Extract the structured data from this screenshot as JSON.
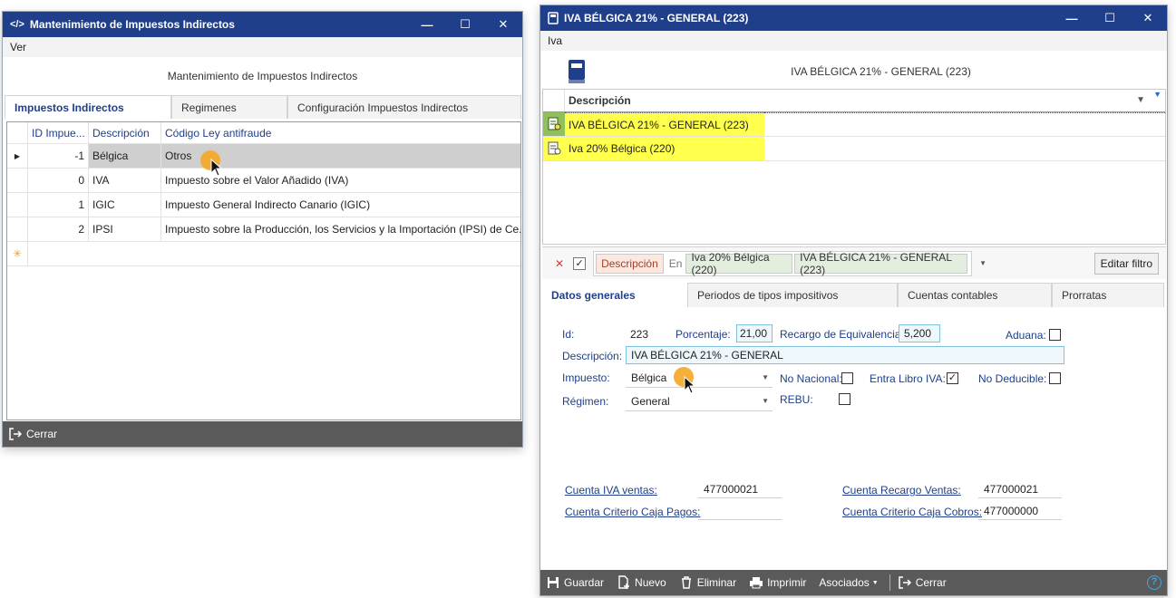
{
  "left_window": {
    "title": "Mantenimiento de Impuestos Indirectos",
    "title_icon": "</>",
    "menu": [
      "Ver"
    ],
    "header": "Mantenimiento de Impuestos Indirectos",
    "tabs": [
      "Impuestos Indirectos",
      "Regimenes",
      "Configuración Impuestos Indirectos"
    ],
    "grid": {
      "columns": [
        "ID Impue...",
        "Descripción",
        "Código Ley antifraude"
      ],
      "rows": [
        {
          "id": "-1",
          "desc": "Bélgica",
          "code": "Otros"
        },
        {
          "id": "0",
          "desc": "IVA",
          "code": "Impuesto sobre el Valor Añadido (IVA)"
        },
        {
          "id": "1",
          "desc": "IGIC",
          "code": "Impuesto General Indirecto Canario (IGIC)"
        },
        {
          "id": "2",
          "desc": "IPSI",
          "code": "Impuesto sobre la Producción, los Servicios y la Importación (IPSI) de Ce..."
        }
      ],
      "new_row_marker": "✳"
    },
    "close_label": "Cerrar"
  },
  "right_window": {
    "title": "IVA BÉLGICA 21% - GENERAL (223)",
    "menu": [
      "Iva"
    ],
    "header": "IVA BÉLGICA 21% - GENERAL (223)",
    "list": {
      "column": "Descripción",
      "items": [
        "IVA BÉLGICA 21% - GENERAL (223)",
        "Iva 20% Bélgica (220)"
      ]
    },
    "filter": {
      "field": "Descripción",
      "operator": "En",
      "values": [
        "Iva 20% Bélgica (220)",
        "IVA BÉLGICA 21% - GENERAL (223)"
      ],
      "edit_label": "Editar filtro"
    },
    "tabs": [
      "Datos generales",
      "Periodos de tipos impositivos",
      "Cuentas contables",
      "Prorratas"
    ],
    "form": {
      "id_label": "Id:",
      "id_value": "223",
      "porcentaje_label": "Porcentaje:",
      "porcentaje_value": "21,00",
      "recargo_label": "Recargo de Equivalencia:",
      "recargo_value": "5,200",
      "aduana_label": "Aduana:",
      "descripcion_label": "Descripción:",
      "descripcion_value": "IVA BÉLGICA 21% - GENERAL",
      "impuesto_label": "Impuesto:",
      "impuesto_value": "Bélgica",
      "no_nacional_label": "No Nacional:",
      "entra_libro_label": "Entra Libro IVA:",
      "no_deducible_label": "No Deducible:",
      "regimen_label": "Régimen:",
      "regimen_value": "General",
      "rebu_label": "REBU:",
      "cuenta_iva_ventas_label": "Cuenta IVA ventas:",
      "cuenta_iva_ventas_value": "477000021",
      "cuenta_recargo_ventas_label": "Cuenta Recargo Ventas:",
      "cuenta_recargo_ventas_value": "477000021",
      "cuenta_caja_pagos_label": "Cuenta Criterio Caja Pagos:",
      "cuenta_caja_pagos_value": "",
      "cuenta_caja_cobros_label": "Cuenta Criterio Caja Cobros:",
      "cuenta_caja_cobros_value": "477000000"
    },
    "checkboxes": {
      "aduana": false,
      "no_nacional": false,
      "entra_libro_iva": true,
      "no_deducible": false,
      "rebu": false
    },
    "toolbar": {
      "guardar": "Guardar",
      "nuevo": "Nuevo",
      "eliminar": "Eliminar",
      "imprimir": "Imprimir",
      "asociados": "Asociados",
      "cerrar": "Cerrar"
    }
  },
  "colors": {
    "titlebar": "#1f3f8a",
    "highlight": "#ffff4d",
    "accent": "#f5a623",
    "bottombar": "#5a5a5a"
  }
}
